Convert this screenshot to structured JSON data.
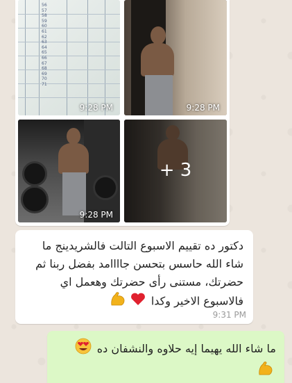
{
  "album": {
    "tiles": [
      {
        "kind": "paper-sheet",
        "time": "9:28 PM"
      },
      {
        "kind": "mirror-selfie",
        "time": "9:28 PM"
      },
      {
        "kind": "gym-selfie",
        "time": "9:28 PM"
      },
      {
        "kind": "mirror-selfie-more",
        "more_label": "+ 3"
      }
    ],
    "sheet_numbers": [
      "56",
      "57",
      "58",
      "59",
      "60",
      "61",
      "62",
      "63",
      "64",
      "65",
      "66",
      "67",
      "68",
      "69",
      "70",
      "71"
    ]
  },
  "incoming_message": {
    "text": "دكتور ده تقييم الاسبوع التالت فالشريدينج ما شاء الله حاسس بتحسن جاااامد بفضل ربنا ثم حضرتك، مستنى رأى حضرتك وهعمل اي فالاسبوع الاخير وكدا",
    "emoji": [
      "heart",
      "flexed-biceps"
    ],
    "time": "9:31 PM"
  },
  "outgoing_message": {
    "text": "ما شاء الله يهيما إيه حلاوه والنشفان ده",
    "emoji": [
      "heart-eyes",
      "flexed-biceps"
    ]
  },
  "colors": {
    "chat_background": "#ece5dd",
    "incoming_bubble": "#ffffff",
    "outgoing_bubble": "#dcf8c6"
  }
}
